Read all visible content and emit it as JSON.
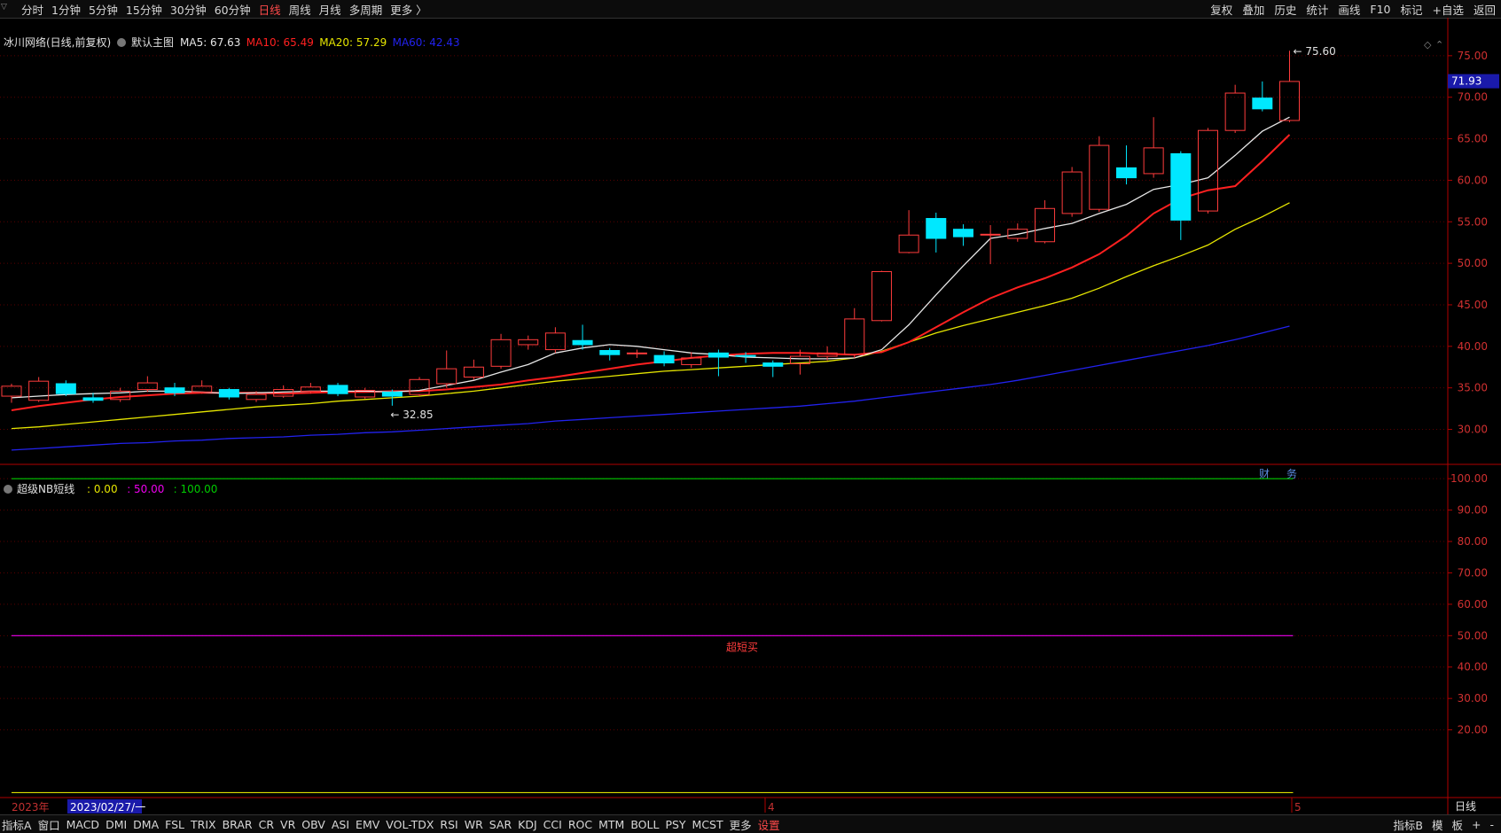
{
  "top_bar": {
    "periods": [
      "分时",
      "1分钟",
      "5分钟",
      "15分钟",
      "30分钟",
      "60分钟",
      "日线",
      "周线",
      "月线",
      "多周期",
      "更多 〉"
    ],
    "active_period": "日线",
    "right_buttons": [
      "复权",
      "叠加",
      "历史",
      "统计",
      "画线",
      "F10",
      "标记",
      "+自选",
      "返回"
    ]
  },
  "bottom_bar": {
    "indicators": [
      "指标A",
      "窗口",
      "MACD",
      "DMI",
      "DMA",
      "FSL",
      "TRIX",
      "BRAR",
      "CR",
      "VR",
      "OBV",
      "ASI",
      "EMV",
      "VOL-TDX",
      "RSI",
      "WR",
      "SAR",
      "KDJ",
      "CCI",
      "ROC",
      "MTM",
      "BOLL",
      "PSY",
      "MCST",
      "更多",
      "设置"
    ],
    "active_item": "设置",
    "right_buttons": [
      "指标B",
      "模",
      "板",
      "+",
      "-"
    ]
  },
  "colors": {
    "up": "#ff3c3c",
    "down": "#00e8ff",
    "ma5": "#e6e6e6",
    "ma10": "#ff2020",
    "ma20": "#e6e600",
    "ma60": "#2222ee",
    "grid": "#5a0000",
    "axis": "#b00000",
    "ind_line100": "#00cc00",
    "ind_line50": "#ee00ee",
    "ind_line0": "#dddd00"
  },
  "chart_data": [
    {
      "type": "candlestick",
      "title": "冰川网络(日线,前复权)",
      "subtitle": "默认主图",
      "ma_legend": [
        {
          "name": "MA5",
          "value": "67.63",
          "color": "#e6e6e6"
        },
        {
          "name": "MA10",
          "value": "65.49",
          "color": "#ff2020"
        },
        {
          "name": "MA20",
          "value": "57.29",
          "color": "#e6e600"
        },
        {
          "name": "MA60",
          "value": "42.43",
          "color": "#2222ee"
        }
      ],
      "y_ticks": [
        "75.00",
        "70.00",
        "65.00",
        "60.00",
        "55.00",
        "50.00",
        "45.00",
        "40.00",
        "35.00",
        "30.00"
      ],
      "ylim": [
        26.0,
        76.8
      ],
      "current_price": "71.93",
      "high_marker": "75.60",
      "low_marker": "32.85",
      "bottom_labels": [
        "财",
        "务"
      ],
      "candles": [
        [
          34.0,
          35.2,
          33.2,
          35.5
        ],
        [
          33.5,
          35.8,
          33.3,
          36.3
        ],
        [
          35.5,
          34.3,
          34.0,
          35.9
        ],
        [
          33.8,
          33.5,
          33.2,
          34.4
        ],
        [
          33.6,
          34.6,
          33.3,
          35.0
        ],
        [
          34.8,
          35.6,
          34.5,
          36.4
        ],
        [
          35.0,
          34.4,
          34.0,
          35.6
        ],
        [
          34.5,
          35.2,
          34.3,
          35.9
        ],
        [
          34.8,
          33.9,
          33.6,
          35.0
        ],
        [
          33.6,
          34.2,
          33.3,
          34.6
        ],
        [
          34.0,
          34.8,
          33.8,
          35.3
        ],
        [
          34.6,
          35.1,
          34.3,
          35.6
        ],
        [
          35.3,
          34.3,
          34.0,
          35.6
        ],
        [
          33.9,
          34.7,
          33.7,
          35.0
        ],
        [
          34.5,
          34.0,
          32.85,
          34.8
        ],
        [
          34.2,
          36.0,
          34.0,
          36.3
        ],
        [
          35.5,
          37.3,
          35.0,
          39.5
        ],
        [
          36.3,
          37.5,
          36.0,
          38.4
        ],
        [
          37.6,
          40.8,
          37.3,
          41.5
        ],
        [
          40.2,
          40.8,
          39.6,
          41.3
        ],
        [
          39.6,
          41.6,
          39.2,
          42.3
        ],
        [
          40.7,
          40.2,
          39.6,
          42.6
        ],
        [
          39.5,
          39.0,
          38.3,
          39.8
        ],
        [
          39.2,
          39.2,
          38.6,
          39.6
        ],
        [
          38.9,
          38.0,
          37.6,
          39.4
        ],
        [
          37.8,
          38.6,
          37.4,
          39.3
        ],
        [
          39.2,
          38.7,
          36.4,
          39.6
        ],
        [
          38.9,
          38.8,
          38.0,
          39.3
        ],
        [
          38.0,
          37.6,
          36.3,
          38.3
        ],
        [
          37.9,
          38.8,
          36.6,
          39.6
        ],
        [
          38.8,
          39.2,
          38.3,
          40.0
        ],
        [
          39.0,
          43.3,
          38.6,
          44.6
        ],
        [
          43.1,
          49.0,
          43.0,
          49.1
        ],
        [
          51.3,
          53.4,
          51.2,
          56.4
        ],
        [
          55.4,
          53.0,
          51.3,
          56.1
        ],
        [
          54.1,
          53.2,
          52.1,
          54.7
        ],
        [
          53.4,
          53.5,
          49.9,
          54.6
        ],
        [
          53.0,
          54.1,
          52.6,
          54.8
        ],
        [
          52.6,
          56.6,
          52.4,
          57.6
        ],
        [
          56.0,
          61.0,
          55.6,
          61.6
        ],
        [
          56.5,
          64.2,
          56.2,
          65.3
        ],
        [
          61.5,
          60.3,
          59.5,
          64.2
        ],
        [
          60.8,
          63.9,
          60.3,
          67.6
        ],
        [
          63.2,
          55.2,
          52.8,
          63.5
        ],
        [
          56.3,
          66.0,
          56.0,
          66.3
        ],
        [
          66.0,
          70.5,
          65.7,
          71.5
        ],
        [
          69.9,
          68.6,
          68.3,
          71.9
        ],
        [
          67.2,
          71.9,
          67.0,
          75.6
        ]
      ],
      "ma5": [
        33.8,
        34.0,
        34.2,
        34.3,
        34.4,
        34.6,
        34.6,
        34.5,
        34.3,
        34.4,
        34.5,
        34.6,
        34.6,
        34.6,
        34.5,
        34.7,
        35.3,
        35.9,
        36.9,
        37.8,
        39.2,
        39.8,
        40.2,
        40.0,
        39.6,
        39.2,
        39.0,
        38.7,
        38.6,
        38.5,
        38.5,
        38.6,
        39.6,
        42.6,
        46.2,
        49.7,
        53.0,
        53.5,
        54.2,
        54.8,
        56.0,
        57.1,
        58.9,
        59.5,
        60.3,
        63.0,
        65.9,
        67.6
      ],
      "ma10": [
        32.3,
        32.8,
        33.2,
        33.6,
        33.9,
        34.1,
        34.3,
        34.4,
        34.4,
        34.4,
        34.3,
        34.4,
        34.5,
        34.5,
        34.6,
        34.6,
        34.8,
        35.1,
        35.4,
        35.9,
        36.3,
        36.8,
        37.3,
        37.8,
        38.2,
        38.6,
        38.9,
        39.1,
        39.2,
        39.2,
        39.1,
        39.0,
        39.3,
        40.5,
        42.3,
        44.1,
        45.8,
        47.1,
        48.2,
        49.5,
        51.1,
        53.3,
        56.0,
        57.8,
        58.8,
        59.3,
        62.3,
        65.49
      ],
      "ma20": [
        30.1,
        30.3,
        30.6,
        30.9,
        31.2,
        31.5,
        31.8,
        32.1,
        32.4,
        32.7,
        32.9,
        33.1,
        33.4,
        33.6,
        33.8,
        34.0,
        34.3,
        34.6,
        35.0,
        35.4,
        35.8,
        36.1,
        36.4,
        36.7,
        37.0,
        37.2,
        37.4,
        37.6,
        37.8,
        38.0,
        38.2,
        38.6,
        39.4,
        40.5,
        41.6,
        42.5,
        43.3,
        44.1,
        44.9,
        45.8,
        47.0,
        48.4,
        49.7,
        50.9,
        52.2,
        54.1,
        55.6,
        57.29
      ],
      "ma60": [
        27.5,
        27.7,
        27.9,
        28.1,
        28.3,
        28.4,
        28.6,
        28.7,
        28.9,
        29.0,
        29.1,
        29.3,
        29.4,
        29.6,
        29.7,
        29.9,
        30.1,
        30.3,
        30.5,
        30.7,
        31.0,
        31.2,
        31.4,
        31.6,
        31.8,
        32.0,
        32.2,
        32.4,
        32.6,
        32.8,
        33.1,
        33.4,
        33.8,
        34.2,
        34.6,
        35.0,
        35.4,
        35.9,
        36.5,
        37.1,
        37.7,
        38.3,
        38.9,
        39.5,
        40.1,
        40.8,
        41.6,
        42.43
      ]
    },
    {
      "type": "line",
      "title": "超级NB短线",
      "legend_values": [
        {
          "value": ": 0.00",
          "color": "#e6e600"
        },
        {
          "value": ": 50.00",
          "color": "#ee00ee"
        },
        {
          "value": ": 100.00",
          "color": "#00cc00"
        }
      ],
      "series_values": [
        0,
        50,
        100
      ],
      "y_ticks": [
        "100.00",
        "90.00",
        "80.00",
        "70.00",
        "60.00",
        "50.00",
        "40.00",
        "30.00",
        "20.00"
      ],
      "ylim": [
        -1.0,
        104.0
      ],
      "annotation": "超短买"
    }
  ],
  "x_axis": {
    "year_label": "2023年",
    "cursor_date": "2023/02/27/一",
    "month_labels": [
      "4",
      "5"
    ],
    "period_label": "日线"
  }
}
